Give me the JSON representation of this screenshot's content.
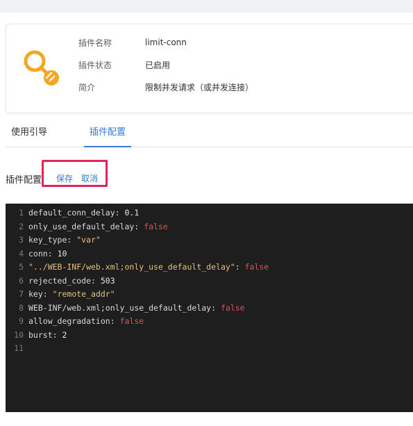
{
  "plugin": {
    "name_label": "插件名称",
    "name_value": "limit-conn",
    "status_label": "插件状态",
    "status_value": "已启用",
    "desc_label": "简介",
    "desc_value": "限制并发请求（或并发连接）",
    "logo_icon": "link-plug-icon",
    "logo_color": "#f5a623"
  },
  "tabs": [
    {
      "label": "使用引导",
      "active": false
    },
    {
      "label": "插件配置",
      "active": true
    }
  ],
  "config": {
    "label": "插件配置",
    "save_label": "保存",
    "cancel_label": "取消"
  },
  "editor": {
    "lines": [
      {
        "num": "1",
        "key": "default_conn_delay",
        "sep": ": ",
        "value": "0.1",
        "type": "num"
      },
      {
        "num": "2",
        "key": "only_use_default_delay",
        "sep": ": ",
        "value": "false",
        "type": "bool"
      },
      {
        "num": "3",
        "key": "key_type",
        "sep": ": ",
        "value": "\"var\"",
        "type": "str"
      },
      {
        "num": "4",
        "key": "conn",
        "sep": ": ",
        "value": "10",
        "type": "num"
      },
      {
        "num": "5",
        "key": "\"../WEB-INF/web.xml;only_use_default_delay\"",
        "sep": ": ",
        "value": "false",
        "type": "bool",
        "key_is_str": true
      },
      {
        "num": "6",
        "key": "rejected_code",
        "sep": ": ",
        "value": "503",
        "type": "num"
      },
      {
        "num": "7",
        "key": "key",
        "sep": ": ",
        "value": "\"remote_addr\"",
        "type": "str"
      },
      {
        "num": "8",
        "key": "WEB-INF/web.xml;only_use_default_delay",
        "sep": ": ",
        "value": "false",
        "type": "bool"
      },
      {
        "num": "9",
        "key": "allow_degradation",
        "sep": ": ",
        "value": "false",
        "type": "bool"
      },
      {
        "num": "10",
        "key": "burst",
        "sep": ": ",
        "value": "2",
        "type": "num"
      },
      {
        "num": "11",
        "key": "",
        "sep": "",
        "value": "",
        "type": "none"
      }
    ]
  },
  "colors": {
    "accent": "#3a7bd5",
    "highlight_border": "#e2245b",
    "editor_bg": "#1e1e1f"
  }
}
